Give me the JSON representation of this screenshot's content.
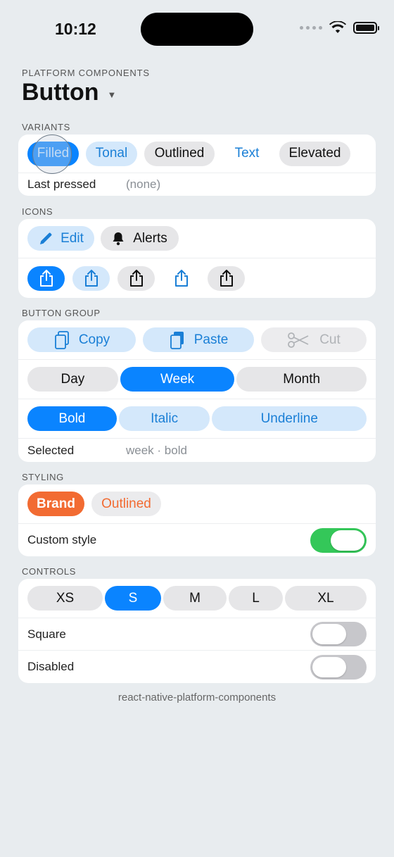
{
  "status": {
    "time": "10:12",
    "battery_level": 1.0
  },
  "header": {
    "eyebrow": "PLATFORM COMPONENTS",
    "title": "Button"
  },
  "variants": {
    "label": "VARIANTS",
    "buttons": [
      "Filled",
      "Tonal",
      "Outlined",
      "Text",
      "Elevated"
    ],
    "last_pressed_label": "Last pressed",
    "last_pressed_value": "(none)"
  },
  "icons": {
    "label": "ICONS",
    "edit": "Edit",
    "alerts": "Alerts",
    "share_icon": "share-icon"
  },
  "button_group": {
    "label": "BUTTON GROUP",
    "clipboard": [
      "Copy",
      "Paste",
      "Cut"
    ],
    "range": [
      "Day",
      "Week",
      "Month"
    ],
    "format": [
      "Bold",
      "Italic",
      "Underline"
    ],
    "selected_label": "Selected",
    "selected_value": "week · bold"
  },
  "styling": {
    "label": "STYLING",
    "brand": "Brand",
    "outlined": "Outlined",
    "custom_style_label": "Custom style",
    "custom_style_on": true,
    "brand_color": "#f26b32"
  },
  "controls": {
    "label": "CONTROLS",
    "sizes": [
      "XS",
      "S",
      "M",
      "L",
      "XL"
    ],
    "selected_size": "S",
    "square_label": "Square",
    "square_on": false,
    "disabled_label": "Disabled",
    "disabled_on": false
  },
  "footer": "react-native-platform-components",
  "colors": {
    "accent": "#0a84ff",
    "tonal_bg": "#d4e8fb",
    "toggle_on": "#34c759"
  }
}
